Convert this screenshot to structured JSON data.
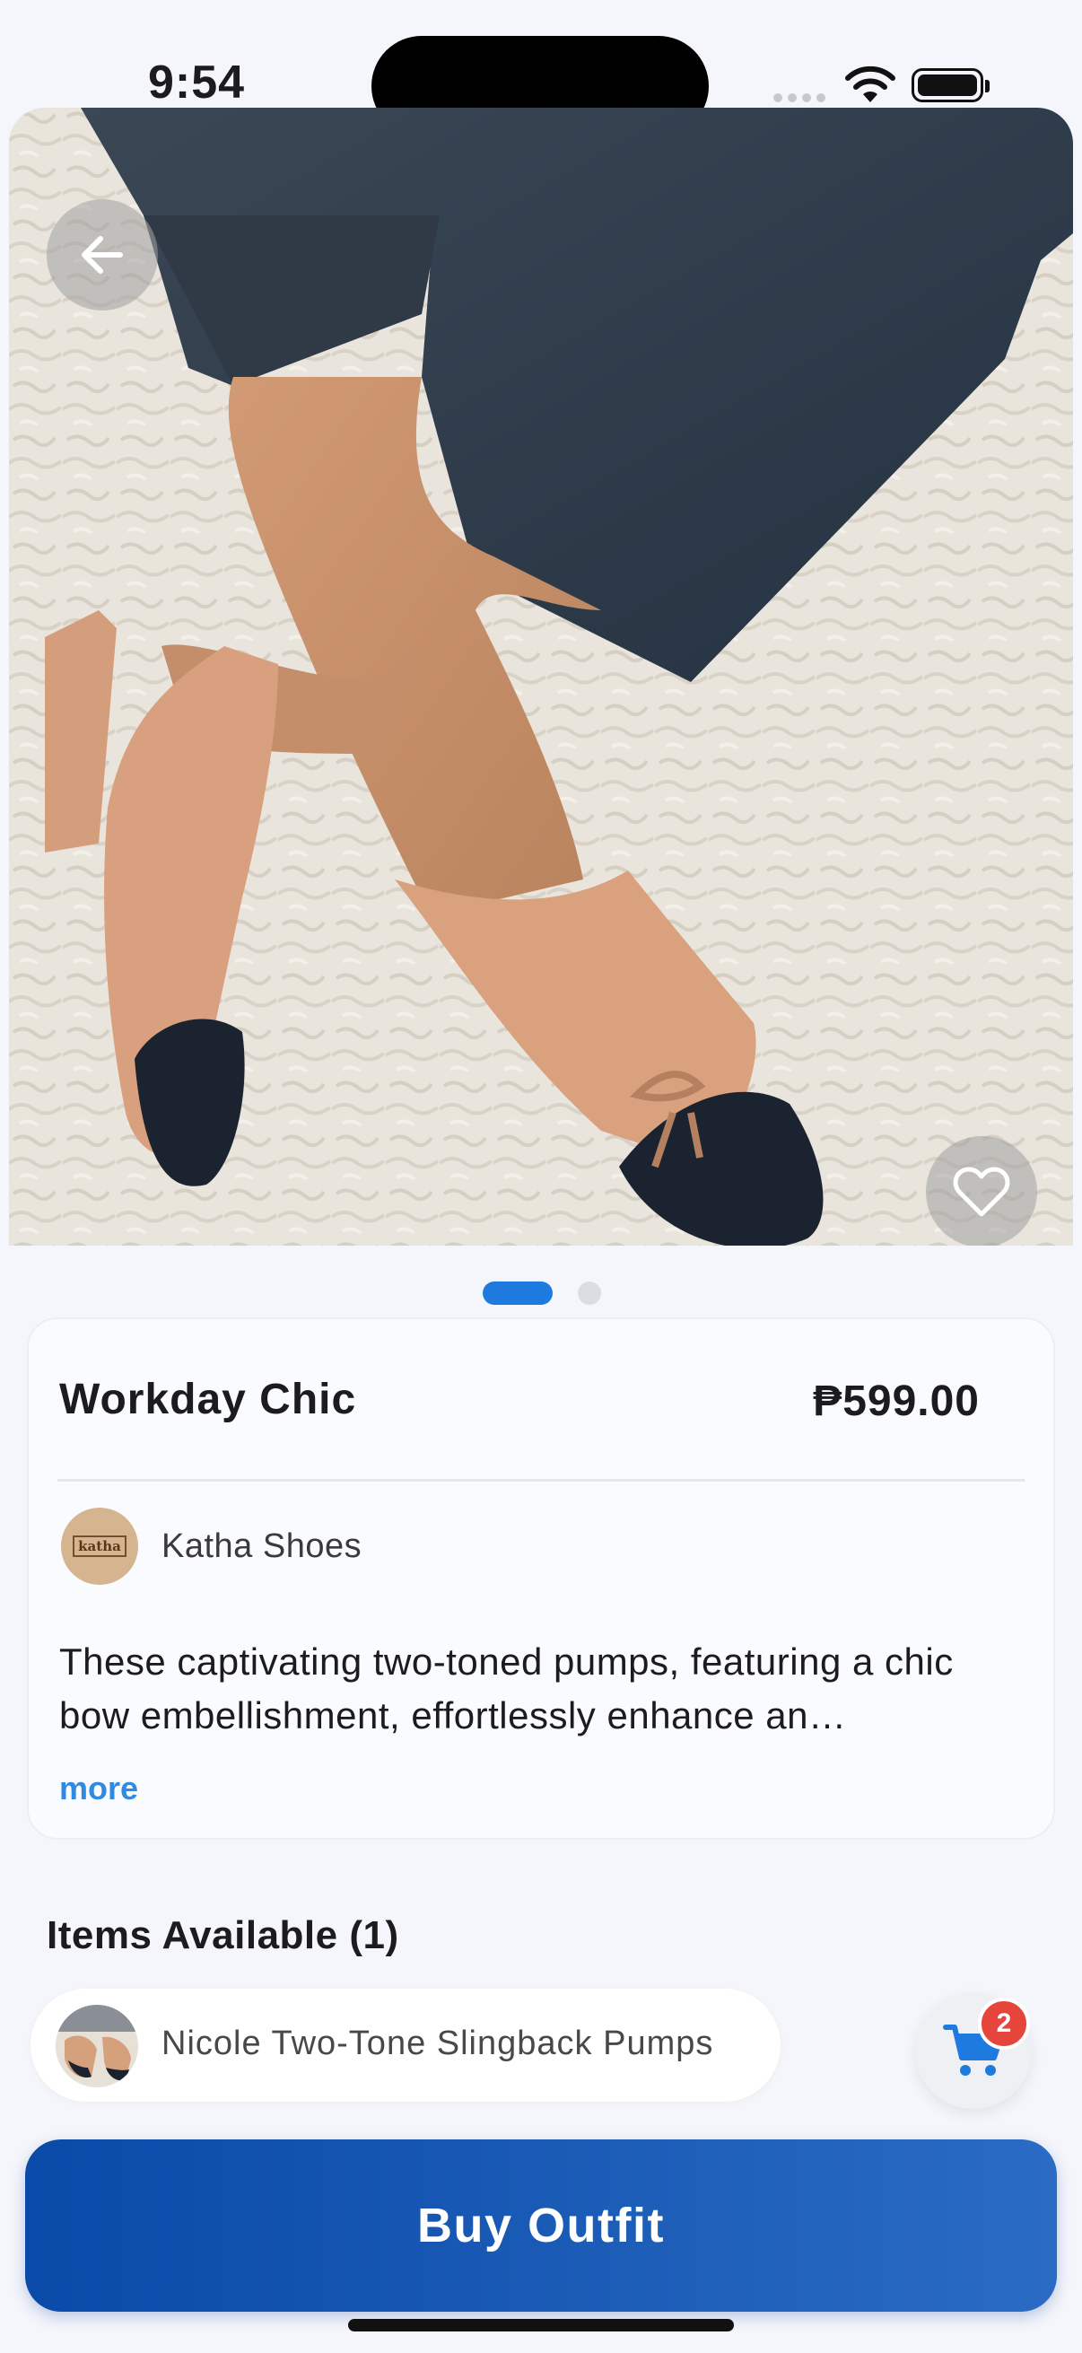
{
  "status_bar": {
    "time": "9:54"
  },
  "hero": {
    "back_icon": "arrow-left-icon",
    "favorite_icon": "heart-outline-icon",
    "pager": {
      "count": 2,
      "active_index": 0
    }
  },
  "product": {
    "title": "Workday Chic",
    "price": "₱599.00",
    "store": {
      "name": "Katha Shoes",
      "logo_text": "katha"
    },
    "description": "These captivating two-toned pumps, featuring a chic bow embellishment, effortlessly enhance an…",
    "more_label": "more"
  },
  "items": {
    "heading": "Items Available (1)",
    "list": [
      {
        "name": "Nicole Two-Tone Slingback Pumps"
      }
    ]
  },
  "cart": {
    "icon": "cart-icon",
    "badge_count": "2"
  },
  "buy_button": {
    "label": "Buy Outfit"
  },
  "colors": {
    "accent": "#1f7ae0",
    "buy_button": "#0a4aa8",
    "badge": "#e5453b",
    "link": "#2f8ae0"
  }
}
